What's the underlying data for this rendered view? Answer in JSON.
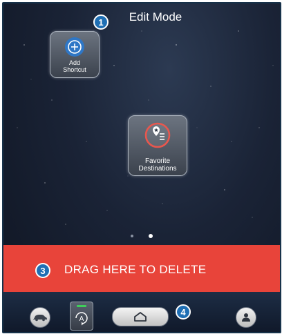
{
  "screen": {
    "title": "Edit Mode",
    "callouts": [
      "1",
      "3",
      "4"
    ]
  },
  "shortcuts": [
    {
      "label_line1": "Add",
      "label_line2": "Shortcut",
      "icon": "plus-circle-icon"
    },
    {
      "label_line1": "Favorite",
      "label_line2": "Destinations",
      "icon": "favorite-destination-icon"
    }
  ],
  "pager": {
    "pages": 2,
    "active_index": 1
  },
  "delete_zone": {
    "label": "DRAG HERE TO DELETE",
    "color": "#e8443a"
  },
  "bottom_bar": {
    "items": [
      "car-icon",
      "auto-icon",
      "home-icon",
      "profile-icon"
    ],
    "auto_indicator_color": "#3ecf5a"
  },
  "colors": {
    "badge": "#1f6fb4",
    "accent_red": "#e8443a",
    "plus_blue": "#2f77c6"
  }
}
